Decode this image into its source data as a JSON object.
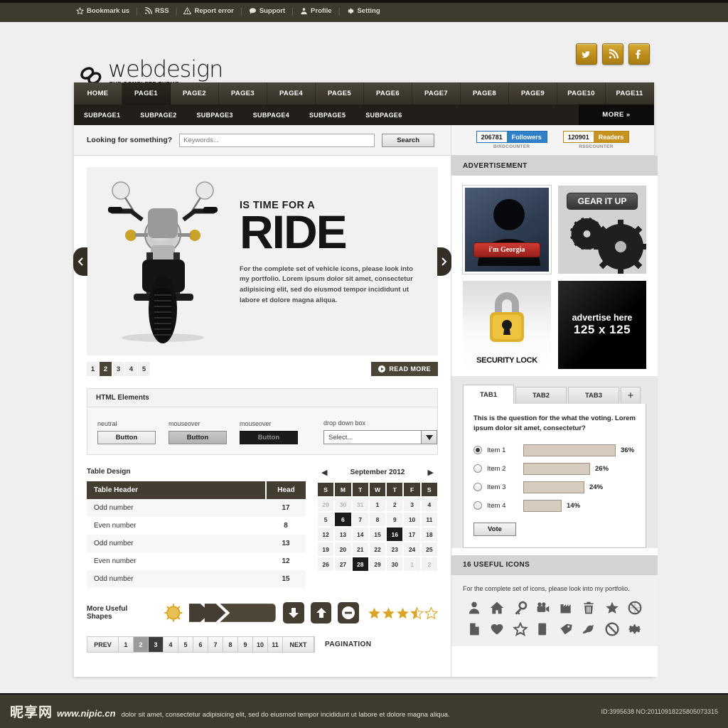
{
  "topbar": {
    "items": [
      {
        "icon": "star-icon",
        "label": "Bookmark us"
      },
      {
        "icon": "rss-icon",
        "label": "RSS"
      },
      {
        "icon": "warning-icon",
        "label": "Report error"
      },
      {
        "icon": "chat-icon",
        "label": "Support"
      },
      {
        "icon": "user-icon",
        "label": "Profile"
      },
      {
        "icon": "gear-icon",
        "label": "Setting"
      }
    ],
    "separator": "|"
  },
  "brand": {
    "name": "webdesign",
    "tagline": "THE COMPLETE THEME",
    "logo_icon": "chain-link-icon"
  },
  "social": [
    {
      "name": "twitter-icon",
      "color": "#bd8e1c"
    },
    {
      "name": "rss-icon",
      "color": "#bd8e1c"
    },
    {
      "name": "facebook-icon",
      "color": "#bd8e1c"
    }
  ],
  "nav": {
    "main": [
      "HOME",
      "PAGE1",
      "PAGE2",
      "PAGE3",
      "PAGE4",
      "PAGE5",
      "PAGE6",
      "PAGE7",
      "PAGE8",
      "PAGE9",
      "PAGE10",
      "PAGE11"
    ],
    "active_index": 1,
    "sub": [
      "SUBPAGE1",
      "SUBPAGE2",
      "SUBPAGE3",
      "SUBPAGE4",
      "SUBPAGE5",
      "SUBPAGE6"
    ],
    "more_label": "MORE »"
  },
  "search": {
    "label": "Looking for something?",
    "placeholder": "Keywords...",
    "button": "Search"
  },
  "counters": [
    {
      "number": "206781",
      "tag": "Followers",
      "caption": "BIRDCOUNTER",
      "color": "#2f80c7"
    },
    {
      "number": "120901",
      "tag": "Readers",
      "caption": "RSSCOUNTER",
      "color": "#c69320"
    }
  ],
  "slider": {
    "kicker": "IS TIME FOR A",
    "title": "RIDE",
    "description": "For the complete set of vehicle icons, please look into my portfolio. Lorem ipsum dolor sit amet, consectetur adipisicing elit, sed do eiusmod tempor incididunt ut labore et dolore magna aliqua.",
    "dots": [
      "1",
      "2",
      "3",
      "4",
      "5"
    ],
    "active_dot": 1,
    "read_more": "READ MORE",
    "prev_icon": "chevron-left-icon",
    "next_icon": "chevron-right-icon"
  },
  "html_elements": {
    "title": "HTML Elements",
    "buttons": [
      {
        "state": "neutral",
        "label": "Button"
      },
      {
        "state": "mouseover",
        "label": "Button"
      },
      {
        "state": "mouseover",
        "label": "Button"
      }
    ],
    "dropdown_label": "drop down box",
    "dropdown_value": "Select..."
  },
  "table": {
    "title": "Table Design",
    "headers": [
      "Table Header",
      "Head"
    ],
    "rows": [
      [
        "Odd number",
        "17"
      ],
      [
        "Even number",
        "8"
      ],
      [
        "Odd number",
        "13"
      ],
      [
        "Even number",
        "12"
      ],
      [
        "Odd number",
        "15"
      ]
    ]
  },
  "calendar": {
    "month": "September 2012",
    "prev_icon": "triangle-left-icon",
    "next_icon": "triangle-right-icon",
    "dow": [
      "S",
      "M",
      "T",
      "W",
      "T",
      "F",
      "S"
    ],
    "weeks": [
      [
        {
          "d": "29",
          "t": "mute"
        },
        {
          "d": "30",
          "t": "mute"
        },
        {
          "d": "31",
          "t": "mute"
        },
        {
          "d": "1",
          "t": "day"
        },
        {
          "d": "2",
          "t": "day"
        },
        {
          "d": "3",
          "t": "day"
        },
        {
          "d": "4",
          "t": "day"
        }
      ],
      [
        {
          "d": "5",
          "t": "day"
        },
        {
          "d": "6",
          "t": "sel"
        },
        {
          "d": "7",
          "t": "day"
        },
        {
          "d": "8",
          "t": "day"
        },
        {
          "d": "9",
          "t": "day"
        },
        {
          "d": "10",
          "t": "day"
        },
        {
          "d": "11",
          "t": "day"
        }
      ],
      [
        {
          "d": "12",
          "t": "day"
        },
        {
          "d": "13",
          "t": "day"
        },
        {
          "d": "14",
          "t": "day"
        },
        {
          "d": "15",
          "t": "day"
        },
        {
          "d": "16",
          "t": "sel"
        },
        {
          "d": "17",
          "t": "day"
        },
        {
          "d": "18",
          "t": "day"
        }
      ],
      [
        {
          "d": "19",
          "t": "day"
        },
        {
          "d": "20",
          "t": "day"
        },
        {
          "d": "21",
          "t": "day"
        },
        {
          "d": "22",
          "t": "day"
        },
        {
          "d": "23",
          "t": "day"
        },
        {
          "d": "24",
          "t": "day"
        },
        {
          "d": "25",
          "t": "day"
        }
      ],
      [
        {
          "d": "26",
          "t": "day"
        },
        {
          "d": "27",
          "t": "day"
        },
        {
          "d": "28",
          "t": "sel"
        },
        {
          "d": "29",
          "t": "day"
        },
        {
          "d": "30",
          "t": "day"
        },
        {
          "d": "1",
          "t": "mute"
        },
        {
          "d": "2",
          "t": "mute"
        }
      ]
    ]
  },
  "shapes": {
    "label": "More Useful Shapes",
    "items": [
      "sunburst-badge-icon",
      "double-chevron-ribbon-icon",
      "arrow-down-icon",
      "arrow-up-icon",
      "minus-circle-icon"
    ],
    "rating_filled": 3,
    "rating_half": 1,
    "rating_total": 5
  },
  "pagination": {
    "prev": "PREV",
    "pages": [
      "1",
      "2",
      "3",
      "4",
      "5",
      "6",
      "7",
      "8",
      "9",
      "10",
      "11"
    ],
    "current_index": 1,
    "active_index": 2,
    "next": "NEXT",
    "label": "PAGINATION"
  },
  "sidebar": {
    "ad_heading": "ADVERTISEMENT",
    "ads": [
      {
        "kind": "georgia",
        "button": "i'm Georgia"
      },
      {
        "kind": "gear",
        "label": "GEAR IT UP"
      },
      {
        "kind": "lock",
        "caption": "SECURITY LOCK",
        "icon": "padlock-icon"
      },
      {
        "kind": "placeholder",
        "line1": "advertise here",
        "line2": "125 x 125"
      }
    ],
    "tabs": [
      {
        "label": "TAB1",
        "active": true
      },
      {
        "label": "TAB2",
        "active": false
      },
      {
        "label": "TAB3",
        "active": false
      },
      {
        "label": "+",
        "active": false
      }
    ],
    "poll": {
      "question": "This is the question for the what the voting. Lorem ipsum dolor sit amet, consectetur?",
      "options": [
        {
          "label": "Item 1",
          "percent": "36%",
          "value": 36,
          "selected": true
        },
        {
          "label": "Item 2",
          "percent": "26%",
          "value": 26,
          "selected": false
        },
        {
          "label": "Item 3",
          "percent": "24%",
          "value": 24,
          "selected": false
        },
        {
          "label": "Item 4",
          "percent": "14%",
          "value": 14,
          "selected": false
        }
      ],
      "vote_button": "Vote"
    },
    "icons_section": {
      "heading": "16 USEFUL ICONS",
      "note": "For the complete set of icons, please look into my portfolio.",
      "icons": [
        "user-icon",
        "home-icon",
        "key-icon",
        "video-camera-icon",
        "factory-icon",
        "trash-icon",
        "star-icon",
        "no-entry-icon",
        "file-icon",
        "heart-icon",
        "star-outline-icon",
        "notebook-icon",
        "tag-icon",
        "bird-icon",
        "prohibited-icon",
        "gear-icon"
      ]
    }
  },
  "footer": {
    "watermark_cn": "昵享网",
    "watermark_url": "www.nipic.cn",
    "watermark_text": "dolor sit amet, consectetur adipisicing elit, sed do eiusmod tempor incididunt ut labore et dolore magna aliqua.",
    "id": "ID:3995638 NO:20110918225805073315"
  }
}
